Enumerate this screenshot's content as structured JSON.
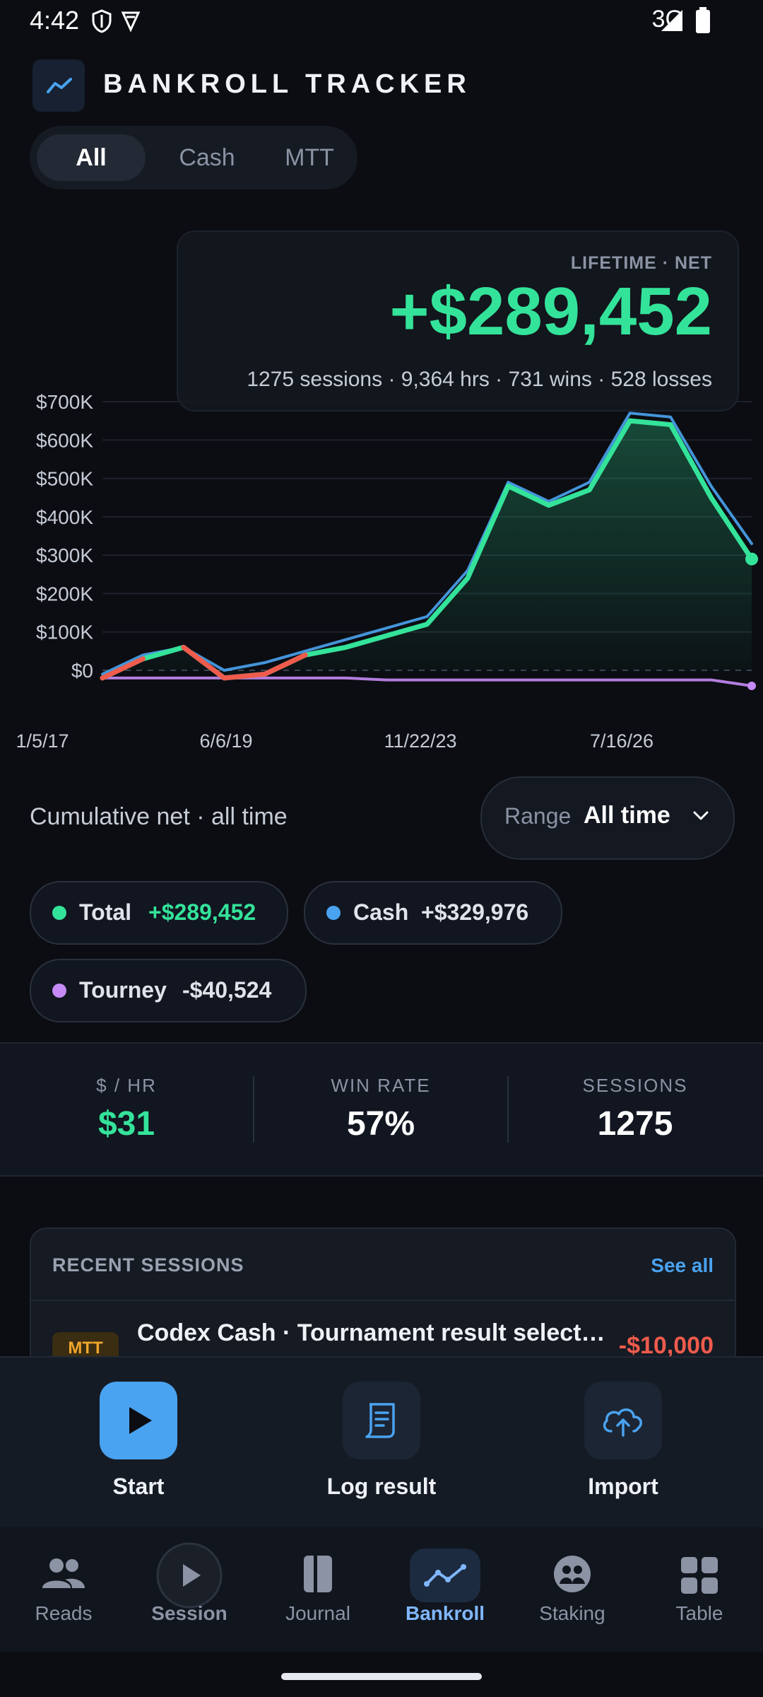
{
  "status": {
    "time": "4:42",
    "network": "3G"
  },
  "header": {
    "title": "BANKROLL TRACKER",
    "logo_icon": "trend-line-icon"
  },
  "filters": {
    "tabs": [
      "All",
      "Cash",
      "MTT"
    ],
    "active": "All"
  },
  "summary": {
    "label": "LIFETIME · NET",
    "value": "+$289,452",
    "subtitle": "1275 sessions · 9,364 hrs · 731 wins · 528 losses"
  },
  "chart_data": {
    "type": "line",
    "y_ticks": [
      "$700K",
      "$600K",
      "$500K",
      "$400K",
      "$300K",
      "$200K",
      "$100K",
      "$0"
    ],
    "x_ticks": [
      "1/5/17",
      "6/6/19",
      "11/22/23",
      "7/16/26"
    ],
    "ylim": [
      0,
      700000
    ],
    "x": [
      "1/5/17",
      "",
      "",
      "6/6/19",
      "",
      "",
      "",
      "11/22/23",
      "",
      "",
      "",
      "",
      "",
      "7/16/26",
      "",
      "",
      ""
    ],
    "series": [
      {
        "name": "Total",
        "color": "#34e39a",
        "values": [
          -20000,
          30000,
          60000,
          -20000,
          -10000,
          40000,
          60000,
          90000,
          120000,
          240000,
          480000,
          430000,
          470000,
          650000,
          640000,
          450000,
          290000
        ]
      },
      {
        "name": "Cash",
        "color": "#4aa3f0",
        "values": [
          -10000,
          40000,
          60000,
          0,
          20000,
          50000,
          80000,
          110000,
          140000,
          260000,
          490000,
          440000,
          490000,
          670000,
          660000,
          480000,
          330000
        ]
      },
      {
        "name": "Tourney",
        "color": "#c58af5",
        "values": [
          -20000,
          -20000,
          -20000,
          -20000,
          -20000,
          -20000,
          -20000,
          -25000,
          -25000,
          -25000,
          -25000,
          -25000,
          -25000,
          -25000,
          -25000,
          -25000,
          -40524
        ]
      }
    ],
    "negative_color": "#ef5b4c",
    "grid": true
  },
  "range": {
    "caption": "Cumulative net · all time",
    "label": "Range",
    "value": "All time"
  },
  "legend": [
    {
      "name": "Total",
      "amount": "+$289,452",
      "dot_color": "#34e39a",
      "amount_color": "#34e39a"
    },
    {
      "name": "Cash",
      "amount": "+$329,976",
      "dot_color": "#4aa3f0",
      "amount_color": "#dfe3ea"
    },
    {
      "name": "Tourney",
      "amount": "-$40,524",
      "dot_color": "#c58af5",
      "amount_color": "#dfe3ea"
    }
  ],
  "stats": [
    {
      "label": "$ / HR",
      "value": "$31",
      "color": "#34e39a"
    },
    {
      "label": "WIN RATE",
      "value": "57%",
      "color": "#ffffff"
    },
    {
      "label": "SESSIONS",
      "value": "1275",
      "color": "#ffffff"
    }
  ],
  "recent": {
    "title": "RECENT SESSIONS",
    "see_all": "See all",
    "items": [
      {
        "badge": "MTT",
        "title": "Codex Cash · Tournament result select…",
        "amount": "-$10,000"
      }
    ]
  },
  "actions": [
    {
      "label": "Start",
      "icon": "play-icon"
    },
    {
      "label": "Log result",
      "icon": "receipt-icon"
    },
    {
      "label": "Import",
      "icon": "cloud-upload-icon"
    }
  ],
  "nav": [
    {
      "label": "Reads",
      "icon": "people-icon"
    },
    {
      "label": "Session",
      "icon": "play-circle-icon"
    },
    {
      "label": "Journal",
      "icon": "book-icon"
    },
    {
      "label": "Bankroll",
      "icon": "trend-line-icon",
      "active": true
    },
    {
      "label": "Staking",
      "icon": "group-icon"
    },
    {
      "label": "Table",
      "icon": "grid-icon"
    }
  ]
}
